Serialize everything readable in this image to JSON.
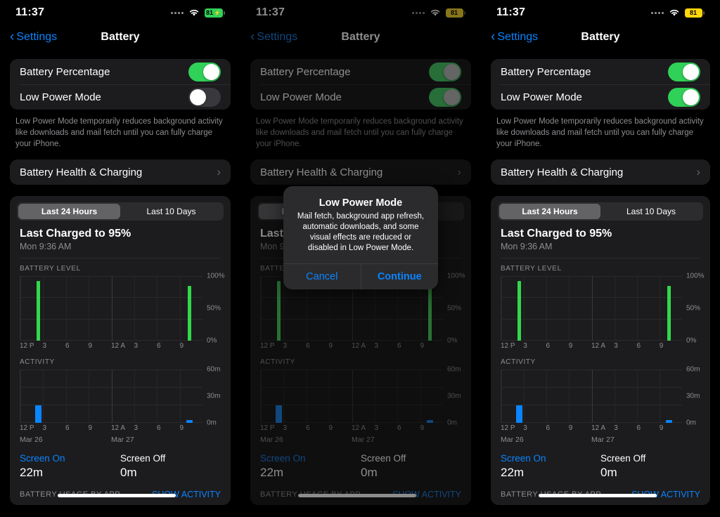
{
  "status_bar": {
    "time": "11:37",
    "battery_percent": "81",
    "charging_bolt": "⚡",
    "wifi_icon": "wifi-icon",
    "cellular_icon": "cellular-dots-icon"
  },
  "nav": {
    "back_label": "Settings",
    "back_chevron": "‹",
    "title": "Battery"
  },
  "settings_rows": {
    "battery_percentage": "Battery Percentage",
    "low_power_mode": "Low Power Mode",
    "footnote": "Low Power Mode temporarily reduces background activity like downloads and mail fetch until you can fully charge your iPhone.",
    "battery_health": "Battery Health & Charging",
    "chevron": "›"
  },
  "usage": {
    "segment_24h": "Last 24 Hours",
    "segment_10d": "Last 10 Days",
    "last_charged_title": "Last Charged to 95%",
    "last_charged_time": "Mon 9:36 AM",
    "battery_level_label": "BATTERY LEVEL",
    "activity_label": "ACTIVITY",
    "screen_on_label": "Screen On",
    "screen_on_value": "22m",
    "screen_off_label": "Screen Off",
    "screen_off_value": "0m",
    "battery_usage_by_app": "BATTERY USAGE BY APP",
    "show_activity": "SHOW ACTIVITY"
  },
  "alert": {
    "title": "Low Power Mode",
    "message": "Mail fetch, background app refresh, automatic downloads, and some visual effects are reduced or disabled in Low Power Mode.",
    "cancel": "Cancel",
    "continue": "Continue"
  },
  "colors": {
    "accent_blue": "#0a84ff",
    "toggle_green": "#30d158",
    "battery_green": "#30d158",
    "battery_yellow": "#ffd60a",
    "bar_green": "#32d74b",
    "bar_blue": "#0a84ff"
  },
  "panels": [
    {
      "id": "panel-1",
      "low_power_mode_on": false,
      "battery_pill_color": "green",
      "dialog_visible": false
    },
    {
      "id": "panel-2",
      "low_power_mode_on": true,
      "battery_pill_color": "yellow",
      "dialog_visible": true
    },
    {
      "id": "panel-3",
      "low_power_mode_on": true,
      "battery_pill_color": "yellow",
      "dialog_visible": false
    }
  ],
  "chart_data": [
    {
      "type": "bar",
      "title": "BATTERY LEVEL",
      "xlabel": "",
      "ylabel": "%",
      "ylim": [
        0,
        100
      ],
      "yticks": [
        "0%",
        "50%",
        "100%"
      ],
      "xticks": [
        "12 P",
        "3",
        "6",
        "9",
        "12 A",
        "3",
        "6",
        "9"
      ],
      "date_labels": [
        "Mar 26",
        "Mar 27"
      ],
      "x": [
        1,
        22
      ],
      "values": [
        95,
        88
      ],
      "bar_color": "#32d74b",
      "grid": true,
      "legend": "none"
    },
    {
      "type": "bar",
      "title": "ACTIVITY",
      "xlabel": "",
      "ylabel": "minutes",
      "ylim": [
        0,
        60
      ],
      "yticks": [
        "0m",
        "30m",
        "60m"
      ],
      "xticks": [
        "12 P",
        "3",
        "6",
        "9",
        "12 A",
        "3",
        "6",
        "9"
      ],
      "date_labels": [
        "Mar 26",
        "Mar 27"
      ],
      "x": [
        1,
        22
      ],
      "values": [
        20,
        2
      ],
      "bar_color": "#0a84ff",
      "grid": true,
      "legend": "none"
    }
  ]
}
